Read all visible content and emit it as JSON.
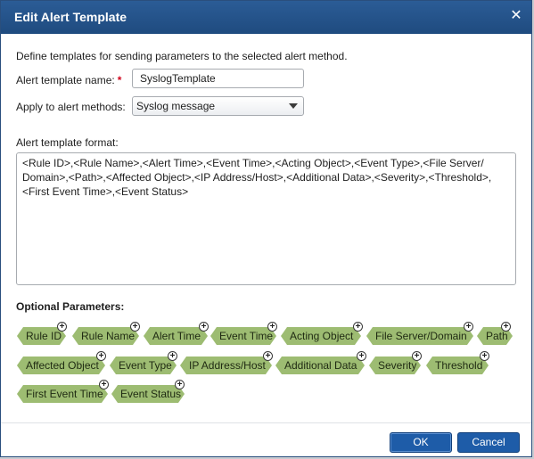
{
  "dialog": {
    "title": "Edit Alert Template",
    "close_icon": "close-icon"
  },
  "form": {
    "description": "Define templates for sending parameters to the selected alert method.",
    "name_label": "Alert template name:",
    "required_mark": "*",
    "name_value": "SyslogTemplate",
    "methods_label": "Apply to alert methods:",
    "methods_value": "Syslog message",
    "format_label": "Alert template format:",
    "format_value": "<Rule ID>,<Rule Name>,<Alert Time>,<Event Time>,<Acting Object>,<Event Type>,<File Server/ Domain>,<Path>,<Affected Object>,<IP Address/Host>,<Additional Data>,<Severity>,<Threshold>,<First Event Time>,<Event Status>"
  },
  "optional": {
    "title": "Optional Parameters:",
    "params": [
      "Rule ID",
      "Rule Name",
      "Alert Time",
      "Event Time",
      "Acting Object",
      "File Server/Domain",
      "Path",
      "Affected Object",
      "Event Type",
      "IP Address/Host",
      "Additional Data",
      "Severity",
      "Threshold",
      "First Event Time",
      "Event Status"
    ]
  },
  "buttons": {
    "ok": "OK",
    "cancel": "Cancel"
  },
  "colors": {
    "titlebar": "#214f86",
    "chip": "#9dbc72",
    "button": "#1e5ca8"
  }
}
